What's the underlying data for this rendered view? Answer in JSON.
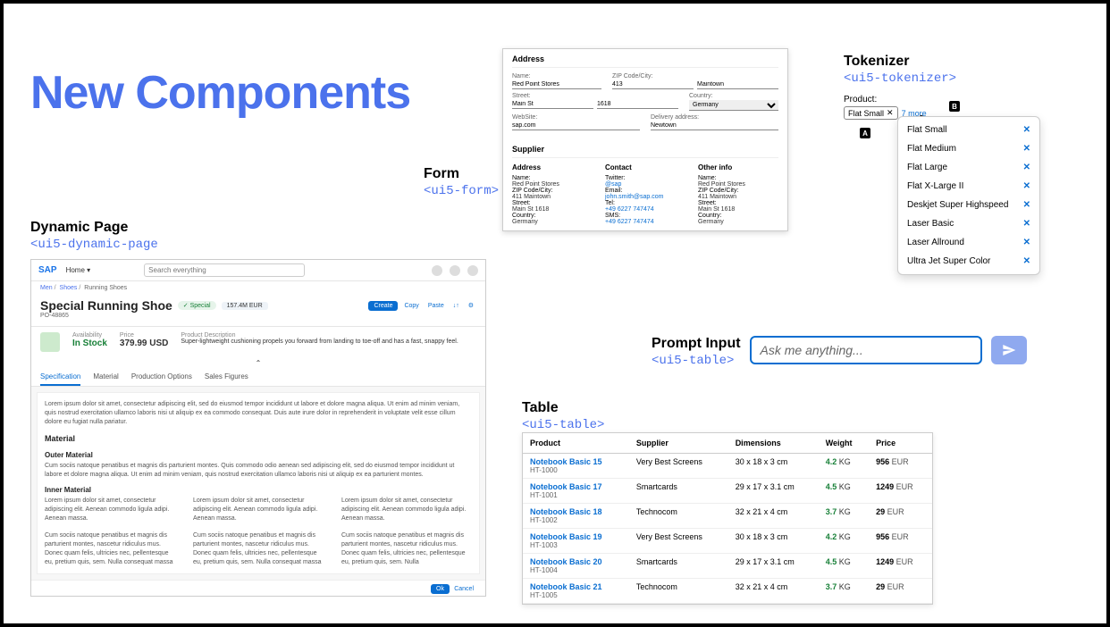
{
  "title": "New Components",
  "dynamic_page": {
    "label": "Dynamic Page",
    "tag": "<ui5-dynamic-page",
    "home": "Home",
    "search_placeholder": "Search everything",
    "crumbs": {
      "a": "Men",
      "b": "Shoes",
      "c": "Running Shoes"
    },
    "heading": "Special Running Shoe",
    "badge": "✓ Special",
    "price_badge": "157.4M EUR",
    "po": "PO-48865",
    "btn_create": "Create",
    "btn_copy": "Copy",
    "btn_paste": "Paste",
    "availability_lbl": "Availability",
    "availability": "In Stock",
    "price_lbl": "Price",
    "price": "379.99 USD",
    "desc_lbl": "Product Description",
    "desc": "Super-lightweight cushioning propels you forward from landing to toe-off and has a fast, snappy feel.",
    "tabs": [
      "Specification",
      "Material",
      "Production Options",
      "Sales Figures"
    ],
    "lorem1": "Lorem ipsum dolor sit amet, consectetur adipiscing elit, sed do eiusmod tempor incididunt ut labore et dolore magna aliqua. Ut enim ad minim veniam, quis nostrud exercitation ullamco laboris nisi ut aliquip ex ea commodo consequat. Duis aute irure dolor in reprehenderit in voluptate velit esse cillum dolore eu fugiat nulla pariatur.",
    "h_material": "Material",
    "h_outer": "Outer Material",
    "outer_txt": "Cum sociis natoque penatibus et magnis dis parturient montes. Quis commodo odio aenean sed adipiscing elit, sed do eiusmod tempor incididunt ut labore et dolore magna aliqua. Ut enim ad minim veniam, quis nostrud exercitation ullamco laboris nisi ut aliquip ex ea parturient montes.",
    "h_inner": "Inner Material",
    "c1": "Lorem ipsum dolor sit amet, consectetur adipiscing elit. Aenean commodo ligula adipi. Aenean massa.",
    "c2": "Lorem ipsum dolor sit amet, consectetur adipiscing elit. Aenean commodo ligula adipi. Aenean massa.",
    "c3": "Lorem ipsum dolor sit amet, consectetur adipiscing elit. Aenean commodo ligula adipi. Aenean massa.",
    "d1": "Cum sociis natoque penatibus et magnis dis parturient montes, nascetur ridiculus mus. Donec quam felis, ultricies nec, pellentesque eu, pretium quis, sem. Nulla consequat massa",
    "d2": "Cum sociis natoque penatibus et magnis dis parturient montes, nascetur ridiculus mus. Donec quam felis, ultricies nec, pellentesque eu, pretium quis, sem. Nulla consequat massa",
    "d3": "Cum sociis natoque penatibus et magnis dis parturient montes, nascetur ridiculus mus. Donec quam felis, ultricies nec, pellentesque eu, pretium quis, sem. Nulla",
    "btn_ok": "Ok",
    "btn_cancel": "Cancel"
  },
  "form": {
    "label": "Form",
    "tag": "<ui5-form>",
    "sec_address": "Address",
    "name_lbl": "Name:",
    "name": "Red Point Stores",
    "zip_lbl": "ZIP Code/City:",
    "zip": "413",
    "city": "Maintown",
    "street_lbl": "Street:",
    "street": "Main St",
    "streetno": "1618",
    "country_lbl": "Country:",
    "country": "Germany",
    "web_lbl": "WebSite:",
    "web": "sap.com",
    "deliv_lbl": "Delivery address:",
    "deliv": "Newtown",
    "sec_supplier": "Supplier",
    "col_address": "Address",
    "col_contact": "Contact",
    "col_other": "Other info",
    "s_name_lbl": "Name:",
    "s_name": "Red Point Stores",
    "s_zip_lbl": "ZIP Code/City:",
    "s_zip": "411 Maintown",
    "s_street_lbl": "Street:",
    "s_street": "Main St 1618",
    "s_country_lbl": "Country:",
    "s_country": "Germany",
    "c_tw_lbl": "Twitter:",
    "c_tw": "@sap",
    "c_em_lbl": "Email:",
    "c_em": "john.smith@sap.com",
    "c_tel_lbl": "Tel:",
    "c_tel": "+49 6227 747474",
    "c_sms_lbl": "SMS:",
    "c_sms": "+49 6227 747474",
    "o_name_lbl": "Name:",
    "o_name": "Red Point Stores",
    "o_zip_lbl": "ZIP Code/City:",
    "o_zip": "411 Maintown",
    "o_street_lbl": "Street:",
    "o_street": "Main St 1618",
    "o_country_lbl": "Country:",
    "o_country": "Germany"
  },
  "prompt": {
    "label": "Prompt Input",
    "tag": "<ui5-table>",
    "placeholder": "Ask me anything..."
  },
  "table": {
    "label": "Table",
    "tag": "<ui5-table>",
    "headers": [
      "Product",
      "Supplier",
      "Dimensions",
      "Weight",
      "Price"
    ],
    "rows": [
      {
        "name": "Notebook Basic 15",
        "code": "HT-1000",
        "supplier": "Very Best Screens",
        "dim": "30 x 18 x 3 cm",
        "wt": "4.2",
        "unit": "KG",
        "price": "956",
        "cur": "EUR"
      },
      {
        "name": "Notebook Basic 17",
        "code": "HT-1001",
        "supplier": "Smartcards",
        "dim": "29 x 17 x 3.1 cm",
        "wt": "4.5",
        "unit": "KG",
        "price": "1249",
        "cur": "EUR"
      },
      {
        "name": "Notebook Basic 18",
        "code": "HT-1002",
        "supplier": "Technocom",
        "dim": "32 x 21 x 4 cm",
        "wt": "3.7",
        "unit": "KG",
        "price": "29",
        "cur": "EUR"
      },
      {
        "name": "Notebook Basic 19",
        "code": "HT-1003",
        "supplier": "Very Best Screens",
        "dim": "30 x 18 x 3 cm",
        "wt": "4.2",
        "unit": "KG",
        "price": "956",
        "cur": "EUR"
      },
      {
        "name": "Notebook Basic 20",
        "code": "HT-1004",
        "supplier": "Smartcards",
        "dim": "29 x 17 x 3.1 cm",
        "wt": "4.5",
        "unit": "KG",
        "price": "1249",
        "cur": "EUR"
      },
      {
        "name": "Notebook Basic 21",
        "code": "HT-1005",
        "supplier": "Technocom",
        "dim": "32 x 21 x 4 cm",
        "wt": "3.7",
        "unit": "KG",
        "price": "29",
        "cur": "EUR"
      }
    ]
  },
  "tokenizer": {
    "label": "Tokenizer",
    "tag": "<ui5-tokenizer>",
    "product_lbl": "Product:",
    "token": "Flat Small",
    "more": "7 more",
    "marker_a": "A",
    "marker_b": "B",
    "items": [
      "Flat Small",
      "Flat Medium",
      "Flat Large",
      "Flat X-Large II",
      "Deskjet Super Highspeed",
      "Laser Basic",
      "Laser Allround",
      "Ultra Jet Super Color"
    ]
  }
}
